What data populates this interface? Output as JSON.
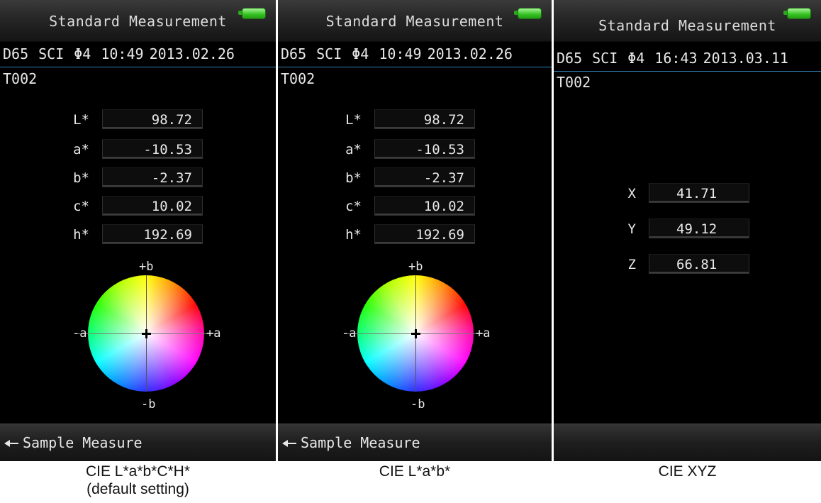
{
  "panels": [
    {
      "title": "Standard Measurement",
      "illuminant": "D65",
      "mode": "SCI",
      "aperture": "Φ4",
      "time": "10:49",
      "date": "2013.02.26",
      "sample_id": "T002",
      "values": [
        {
          "label": "L*",
          "value": "98.72"
        },
        {
          "label": "a*",
          "value": "-10.53"
        },
        {
          "label": "b*",
          "value": "-2.37"
        },
        {
          "label": "c*",
          "value": "10.02"
        },
        {
          "label": "h*",
          "value": "192.69"
        }
      ],
      "axes": {
        "plus_b": "+b",
        "minus_b": "-b",
        "minus_a": "-a",
        "plus_a": "+a"
      },
      "bottom_label": "Sample Measure",
      "caption_line1": "CIE L*a*b*C*H*",
      "caption_line2": "(default setting)"
    },
    {
      "title": "Standard Measurement",
      "illuminant": "D65",
      "mode": "SCI",
      "aperture": "Φ4",
      "time": "10:49",
      "date": "2013.02.26",
      "sample_id": "T002",
      "values": [
        {
          "label": "L*",
          "value": "98.72"
        },
        {
          "label": "a*",
          "value": "-10.53"
        },
        {
          "label": "b*",
          "value": "-2.37"
        },
        {
          "label": "c*",
          "value": "10.02"
        },
        {
          "label": "h*",
          "value": "192.69"
        }
      ],
      "axes": {
        "plus_b": "+b",
        "minus_b": "-b",
        "minus_a": "-a",
        "plus_a": "+a"
      },
      "bottom_label": "Sample Measure",
      "caption_line1": "CIE L*a*b*"
    },
    {
      "title": "Standard Measurement",
      "illuminant": "D65",
      "mode": "SCI",
      "aperture": "Φ4",
      "time": "16:43",
      "date": "2013.03.11",
      "sample_id": "T002",
      "values": [
        {
          "label": "X",
          "value": "41.71"
        },
        {
          "label": "Y",
          "value": "49.12"
        },
        {
          "label": "Z",
          "value": "66.81"
        }
      ],
      "caption_line1": "CIE XYZ"
    }
  ],
  "icons": {
    "battery": "battery-icon",
    "enter": "enter-return-icon"
  },
  "colors": {
    "screen_bg": "#000000",
    "divider": "#2f7fb0",
    "battery": "#33c21f"
  }
}
